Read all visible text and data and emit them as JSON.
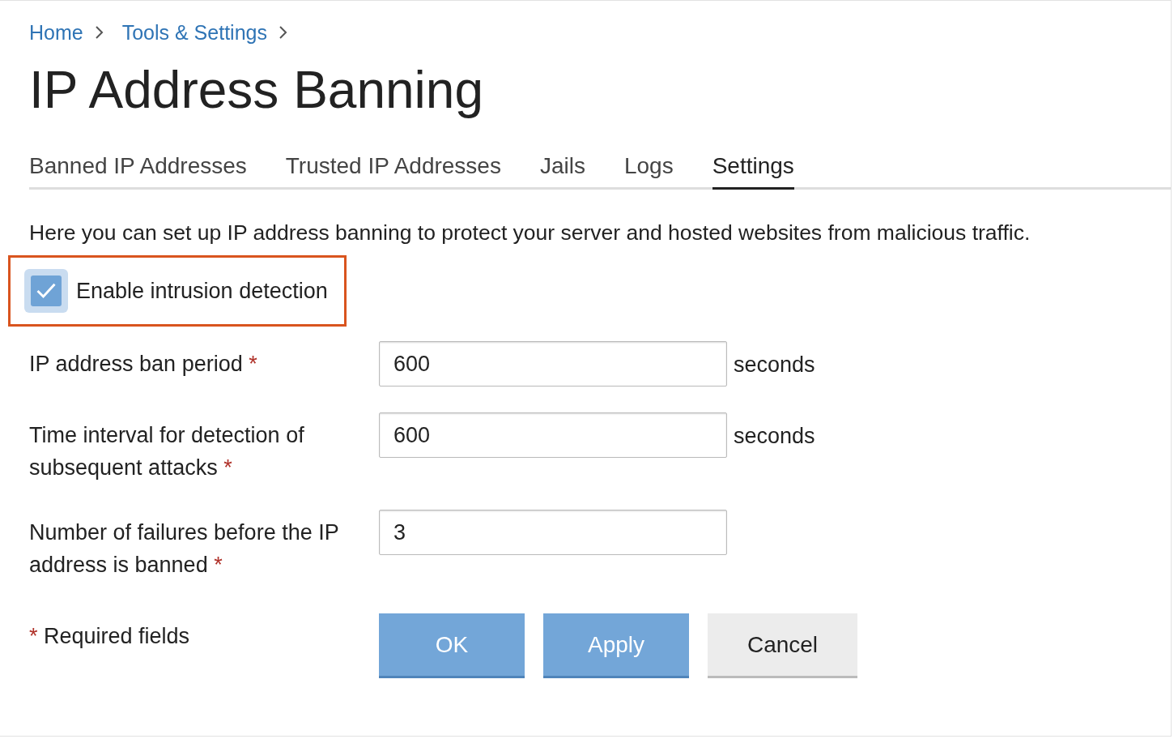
{
  "breadcrumb": [
    {
      "label": "Home"
    },
    {
      "label": "Tools & Settings"
    }
  ],
  "title": "IP Address Banning",
  "tabs": [
    {
      "label": "Banned IP Addresses",
      "selected": false
    },
    {
      "label": "Trusted IP Addresses",
      "selected": false
    },
    {
      "label": "Jails",
      "selected": false
    },
    {
      "label": "Logs",
      "selected": false
    },
    {
      "label": "Settings",
      "selected": true
    }
  ],
  "description": "Here you can set up IP address banning to protect your server and hosted websites from malicious traffic.",
  "checkbox": {
    "label": "Enable intrusion detection",
    "checked": true,
    "highlighted": true
  },
  "fields": [
    {
      "label": "IP address ban period",
      "required_mark": "*",
      "value": "600",
      "unit": "seconds"
    },
    {
      "label": "Time interval for detection of subsequent attacks",
      "required_mark": "*",
      "value": "600",
      "unit": "seconds"
    },
    {
      "label": "Number of failures before the IP address is banned",
      "required_mark": "*",
      "value": "3"
    }
  ],
  "required_note": {
    "mark": "*",
    "text": "Required fields"
  },
  "buttons": [
    {
      "label": "OK",
      "kind": "primary"
    },
    {
      "label": "Apply",
      "kind": "primary"
    },
    {
      "label": "Cancel",
      "kind": "secondary"
    }
  ]
}
